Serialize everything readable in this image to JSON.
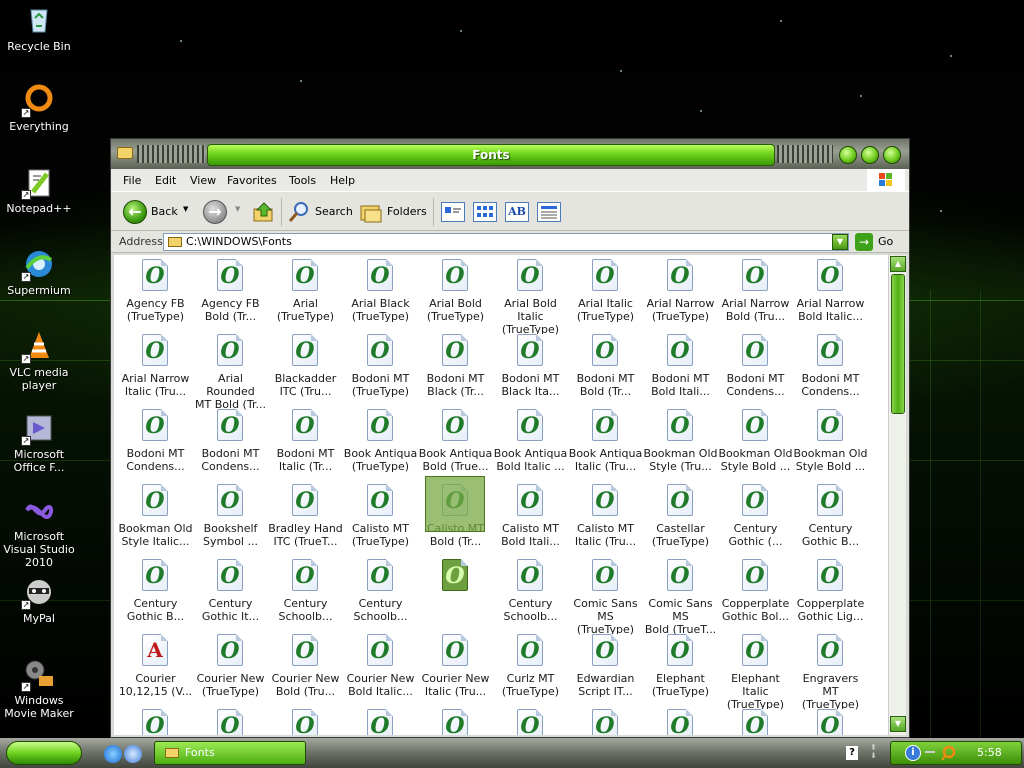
{
  "desktop": {
    "icons": [
      {
        "label": "Recycle Bin",
        "icon": "recycle-bin-icon"
      },
      {
        "label": "Everything",
        "icon": "everything-search-icon"
      },
      {
        "label": "Notepad++",
        "icon": "notepad-plus-plus-icon"
      },
      {
        "label": "Supermium",
        "icon": "supermium-browser-icon"
      },
      {
        "label": "VLC media player",
        "icon": "vlc-cone-icon"
      },
      {
        "label": "Microsoft Office F...",
        "icon": "office-icon"
      },
      {
        "label": "Microsoft Visual Studio 2010",
        "icon": "visual-studio-icon"
      },
      {
        "label": "MyPal",
        "icon": "mypal-raccoon-icon"
      },
      {
        "label": "Windows Movie Maker",
        "icon": "movie-maker-icon"
      }
    ]
  },
  "window": {
    "title": "Fonts",
    "menu": [
      "File",
      "Edit",
      "View",
      "Favorites",
      "Tools",
      "Help"
    ],
    "toolbar": {
      "back_label": "Back",
      "search_label": "Search",
      "folders_label": "Folders"
    },
    "address": {
      "label": "Address",
      "value": "C:\\WINDOWS\\Fonts",
      "go_label": "Go"
    },
    "fonts": [
      {
        "line1": "Agency FB",
        "line2": "(TrueType)"
      },
      {
        "line1": "Agency FB",
        "line2": "Bold (Tr..."
      },
      {
        "line1": "Arial",
        "line2": "(TrueType)"
      },
      {
        "line1": "Arial Black",
        "line2": "(TrueType)"
      },
      {
        "line1": "Arial Bold",
        "line2": "(TrueType)"
      },
      {
        "line1": "Arial Bold Italic",
        "line2": "(TrueType)"
      },
      {
        "line1": "Arial Italic",
        "line2": "(TrueType)"
      },
      {
        "line1": "Arial Narrow",
        "line2": "(TrueType)"
      },
      {
        "line1": "Arial Narrow",
        "line2": "Bold (Tru..."
      },
      {
        "line1": "Arial Narrow",
        "line2": "Bold Italic..."
      },
      {
        "line1": "Arial Narrow",
        "line2": "Italic (Tru..."
      },
      {
        "line1": "Arial Rounded",
        "line2": "MT Bold (Tr..."
      },
      {
        "line1": "Blackadder",
        "line2": "ITC (Tru..."
      },
      {
        "line1": "Bodoni MT",
        "line2": "(TrueType)"
      },
      {
        "line1": "Bodoni MT",
        "line2": "Black (Tr..."
      },
      {
        "line1": "Bodoni MT",
        "line2": "Black Ita..."
      },
      {
        "line1": "Bodoni MT",
        "line2": "Bold (Tr..."
      },
      {
        "line1": "Bodoni MT",
        "line2": "Bold Itali..."
      },
      {
        "line1": "Bodoni MT",
        "line2": "Condens..."
      },
      {
        "line1": "Bodoni MT",
        "line2": "Condens..."
      },
      {
        "line1": "Bodoni MT",
        "line2": "Condens..."
      },
      {
        "line1": "Bodoni MT",
        "line2": "Condens..."
      },
      {
        "line1": "Bodoni MT",
        "line2": "Italic (Tr..."
      },
      {
        "line1": "Book Antiqua",
        "line2": "(TrueType)"
      },
      {
        "line1": "Book Antiqua",
        "line2": "Bold (True..."
      },
      {
        "line1": "Book Antiqua",
        "line2": "Bold Italic ..."
      },
      {
        "line1": "Book Antiqua",
        "line2": "Italic (Tru..."
      },
      {
        "line1": "Bookman Old",
        "line2": "Style (Tru..."
      },
      {
        "line1": "Bookman Old",
        "line2": "Style Bold ..."
      },
      {
        "line1": "Bookman Old",
        "line2": "Style Bold ..."
      },
      {
        "line1": "Bookman Old",
        "line2": "Style Italic..."
      },
      {
        "line1": "Bookshelf",
        "line2": "Symbol ..."
      },
      {
        "line1": "Bradley Hand",
        "line2": "ITC (TrueT..."
      },
      {
        "line1": "Calisto MT",
        "line2": "(TrueType)"
      },
      {
        "line1": "Calisto MT",
        "line2": "Bold (Tr..."
      },
      {
        "line1": "Calisto MT",
        "line2": "Bold Itali..."
      },
      {
        "line1": "Calisto MT",
        "line2": "Italic (Tru..."
      },
      {
        "line1": "Castellar",
        "line2": "(TrueType)"
      },
      {
        "line1": "Century",
        "line2": "Gothic (..."
      },
      {
        "line1": "Century",
        "line2": "Gothic B..."
      },
      {
        "line1": "Century",
        "line2": "Gothic B..."
      },
      {
        "line1": "Century",
        "line2": "Gothic It..."
      },
      {
        "line1": "Century",
        "line2": "Schoolb..."
      },
      {
        "line1": "Century",
        "line2": "Schoolb..."
      },
      {
        "line1": "",
        "line2": "",
        "selected": true
      },
      {
        "line1": "Century",
        "line2": "Schoolb..."
      },
      {
        "line1": "Comic Sans MS",
        "line2": "(TrueType)"
      },
      {
        "line1": "Comic Sans MS",
        "line2": "Bold (TrueT..."
      },
      {
        "line1": "Copperplate",
        "line2": "Gothic Bol..."
      },
      {
        "line1": "Copperplate",
        "line2": "Gothic Lig..."
      },
      {
        "line1": "Courier",
        "line2": "10,12,15 (V...",
        "raster": true
      },
      {
        "line1": "Courier New",
        "line2": "(TrueType)"
      },
      {
        "line1": "Courier New",
        "line2": "Bold (Tru..."
      },
      {
        "line1": "Courier New",
        "line2": "Bold Italic..."
      },
      {
        "line1": "Courier New",
        "line2": "Italic (Tru..."
      },
      {
        "line1": "Curlz MT",
        "line2": "(TrueType)"
      },
      {
        "line1": "Edwardian",
        "line2": "Script IT..."
      },
      {
        "line1": "Elephant",
        "line2": "(TrueType)"
      },
      {
        "line1": "Elephant Italic",
        "line2": "(TrueType)"
      },
      {
        "line1": "Engravers MT",
        "line2": "(TrueType)"
      },
      {
        "line1": "",
        "line2": ""
      },
      {
        "line1": "",
        "line2": ""
      },
      {
        "line1": "",
        "line2": ""
      },
      {
        "line1": "",
        "line2": ""
      },
      {
        "line1": "",
        "line2": ""
      },
      {
        "line1": "",
        "line2": ""
      },
      {
        "line1": "",
        "line2": ""
      },
      {
        "line1": "",
        "line2": ""
      },
      {
        "line1": "",
        "line2": ""
      },
      {
        "line1": "",
        "line2": ""
      }
    ],
    "glyph_truetype": "O",
    "glyph_raster": "A"
  },
  "taskbar": {
    "task_label": "Fonts",
    "clock": "5:58 PM",
    "help_glyph": "?"
  },
  "colors": {
    "accent_green": "#6ed21a",
    "truetype_glyph": "#1f7a2a",
    "raster_glyph": "#c01818"
  }
}
